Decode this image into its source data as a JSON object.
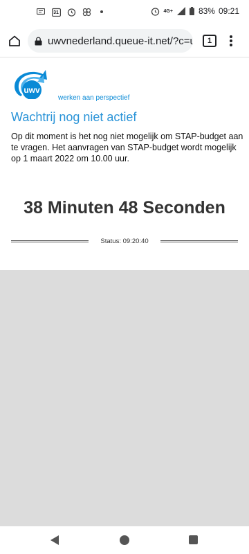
{
  "status_bar": {
    "network": "4G+",
    "battery": "83%",
    "time": "09:21",
    "icons": [
      "message-icon",
      "calendar-icon",
      "alarm-icon",
      "pinwheel-icon",
      "dot-icon",
      "alarm-icon",
      "signal-icon",
      "battery-icon"
    ],
    "calendar_day": "31"
  },
  "browser": {
    "url": "uwvnederland.queue-it.net/?c=uwv",
    "tab_count": "1"
  },
  "page": {
    "logo_text": "uwv",
    "logo_tagline": "werken aan perspectief",
    "heading": "Wachtrij nog niet actief",
    "intro": "Op dit moment is het nog niet mogelijk om STAP-budget aan te vragen. Het aanvragen van STAP-budget wordt mogelijk op 1 maart 2022 om 10.00 uur.",
    "countdown": "38 Minuten 48 Seconden",
    "status": "Status: 09:20:40"
  },
  "colors": {
    "accent": "#2b94d8",
    "logo_blue": "#0a8ad6",
    "grey_area": "#dcdcdc"
  }
}
